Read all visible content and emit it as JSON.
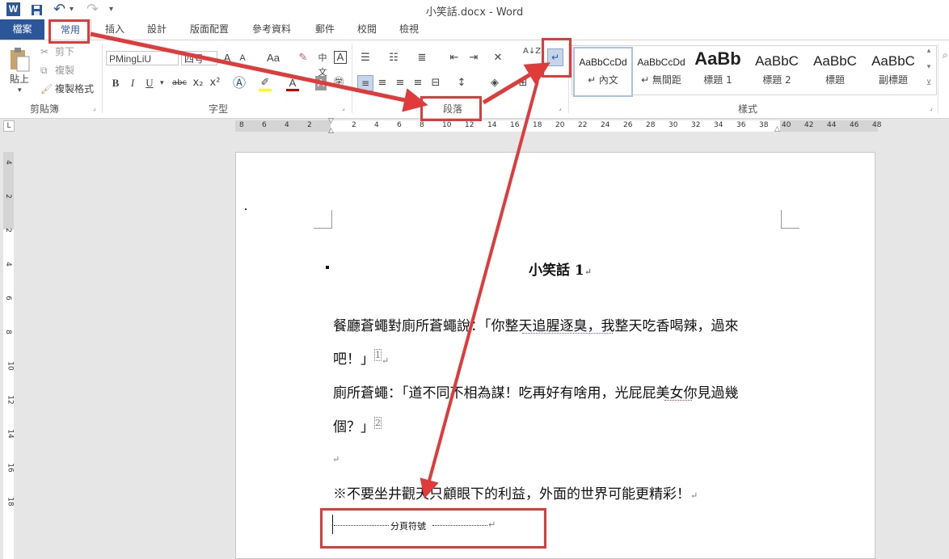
{
  "window": {
    "title": "小笑話.docx - Word"
  },
  "qat": {
    "word_icon": "W",
    "save_icon": "save-icon",
    "undo_icon": "↶",
    "redo_icon": "↷",
    "more_icon": "▾"
  },
  "tabs": [
    "檔案",
    "常用",
    "插入",
    "設計",
    "版面配置",
    "參考資料",
    "郵件",
    "校閱",
    "檢視"
  ],
  "clipboard": {
    "paste": "貼上",
    "cut": "剪下",
    "copy": "複製",
    "format_painter": "複製格式",
    "group_label": "剪貼簿"
  },
  "font": {
    "font_name": "PMingLiU",
    "font_size": "四号",
    "bold": "B",
    "italic": "I",
    "underline": "U",
    "strike": "abc",
    "subscript": "x₂",
    "superscript": "x²",
    "group_label": "字型",
    "grow": "A",
    "shrink": "A",
    "case": "Aa",
    "phonetic": "中文",
    "char_border": "A"
  },
  "paragraph": {
    "group_label": "段落",
    "sort": "A↓Z",
    "show_marks": "↵"
  },
  "styles": {
    "group_label": "樣式",
    "items": [
      {
        "sample": "AaBbCcDd",
        "name": "↵ 內文"
      },
      {
        "sample": "AaBbCcDd",
        "name": "↵ 無間距"
      },
      {
        "sample": "AaBb",
        "name": "標題 1"
      },
      {
        "sample": "AaBbC",
        "name": "標題 2"
      },
      {
        "sample": "AaBbC",
        "name": "標題"
      },
      {
        "sample": "AaBbC",
        "name": "副標題"
      }
    ]
  },
  "ruler": {
    "left_numbers": [
      "8",
      "6",
      "4",
      "2"
    ],
    "numbers": [
      "2",
      "4",
      "6",
      "8",
      "10",
      "12",
      "14",
      "16",
      "18",
      "20",
      "22",
      "24",
      "26",
      "28",
      "30",
      "32",
      "34",
      "36",
      "38",
      "40",
      "42",
      "44",
      "46",
      "48"
    ],
    "vertical_numbers": [
      "4",
      "2",
      "2",
      "4",
      "6",
      "8",
      "10",
      "12",
      "14",
      "16",
      "18"
    ]
  },
  "document": {
    "title": "小笑話 1",
    "para1_line1": "餐廳蒼蠅對廁所蒼蠅說：「你整天追腥逐臭，我整天吃香喝辣，過來",
    "para1_line2": "吧！」",
    "para2_line1": "廁所蒼蠅：「道不同不相為謀！吃再好有啥用，光屁屁美女你見過幾",
    "para2_line2": "個？」",
    "footnote_1": "1",
    "footnote_2": "2",
    "moral": "※不要坐井觀天只顧眼下的利益，外面的世界可能更精彩！",
    "page_break": "分頁符號",
    "para_mark": "↵"
  },
  "colors": {
    "accent": "#2b579a",
    "highlight": "#e03a3a"
  }
}
